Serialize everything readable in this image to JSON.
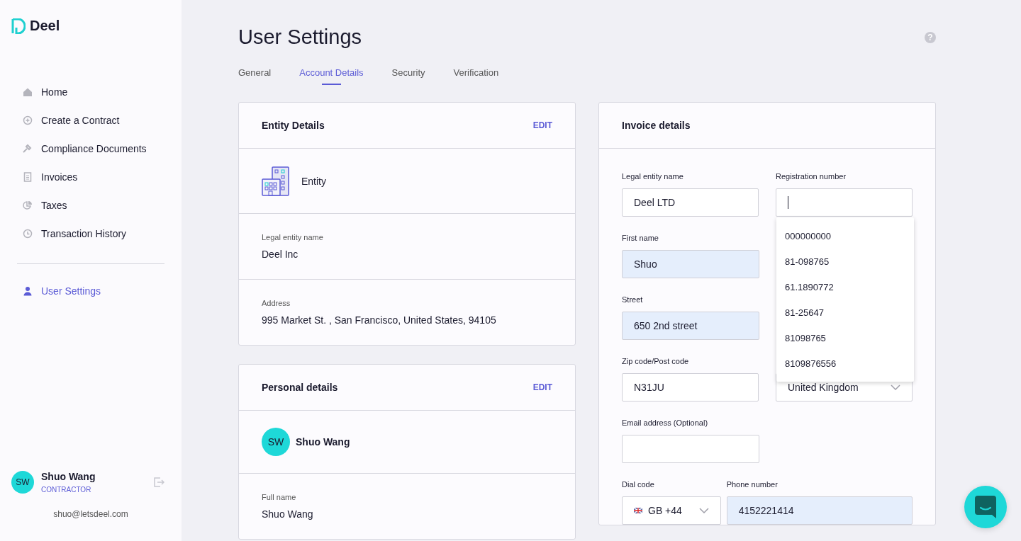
{
  "brand": {
    "name": "Deel"
  },
  "nav": [
    {
      "label": "Home",
      "selected": false
    },
    {
      "label": "Create a Contract",
      "selected": false
    },
    {
      "label": "Compliance Documents",
      "selected": false
    },
    {
      "label": "Invoices",
      "selected": false
    },
    {
      "label": "Taxes",
      "selected": false
    },
    {
      "label": "Transaction History",
      "selected": false
    }
  ],
  "nav_bottom": [
    {
      "label": "User Settings",
      "selected": true
    }
  ],
  "user": {
    "initials": "SW",
    "name": "Shuo Wang",
    "role": "CONTRACTOR",
    "email": "shuo@letsdeel.com"
  },
  "page": {
    "title": "User Settings",
    "help": "?"
  },
  "tabs": [
    {
      "label": "General",
      "selected": false
    },
    {
      "label": "Account Details",
      "selected": true
    },
    {
      "label": "Security",
      "selected": false
    },
    {
      "label": "Verification",
      "selected": false
    }
  ],
  "entity_card": {
    "title": "Entity Details",
    "action": "EDIT",
    "entity_label": "Entity",
    "fields": [
      {
        "label": "Legal entity name",
        "value": "Deel Inc"
      },
      {
        "label": "Address",
        "value": "995 Market St. , San Francisco, United States, 94105"
      }
    ]
  },
  "personal_card": {
    "title": "Personal details",
    "action": "EDIT",
    "initials": "SW",
    "name": "Shuo Wang",
    "fields": [
      {
        "label": "Full name",
        "value": "Shuo Wang"
      }
    ]
  },
  "invoice_card": {
    "title": "Invoice details",
    "lines": [
      [
        {
          "kind": "input",
          "label": "Legal entity name",
          "value": "Deel LTD",
          "autofilled": false,
          "focused": false
        },
        {
          "kind": "input",
          "label": "Registration number",
          "autofilled": false,
          "focused": true
        }
      ],
      [
        {
          "kind": "input",
          "label": "First name",
          "value": "Shuo",
          "autofilled": true,
          "focused": false
        }
      ],
      [
        {
          "kind": "input",
          "label": "Street",
          "value": "650 2nd street",
          "autofilled": true,
          "focused": false
        }
      ],
      [
        {
          "kind": "input",
          "label": "Zip code/Post code",
          "value": "N31JU",
          "autofilled": false,
          "focused": false
        },
        {
          "kind": "select",
          "value": "United Kingdom"
        }
      ],
      [
        {
          "kind": "input",
          "label": "Email address (Optional)",
          "autofilled": false,
          "focused": false
        }
      ],
      [
        {
          "kind": "dial",
          "label": "Dial code",
          "value": "GB +44"
        },
        {
          "kind": "input",
          "label": "Phone number",
          "value": "4152221414",
          "autofilled": true,
          "focused": false
        }
      ]
    ],
    "suggestions": [
      "000000000",
      "81-098765",
      "61.1890772",
      "81-25647",
      "81098765",
      "8109876556"
    ]
  }
}
